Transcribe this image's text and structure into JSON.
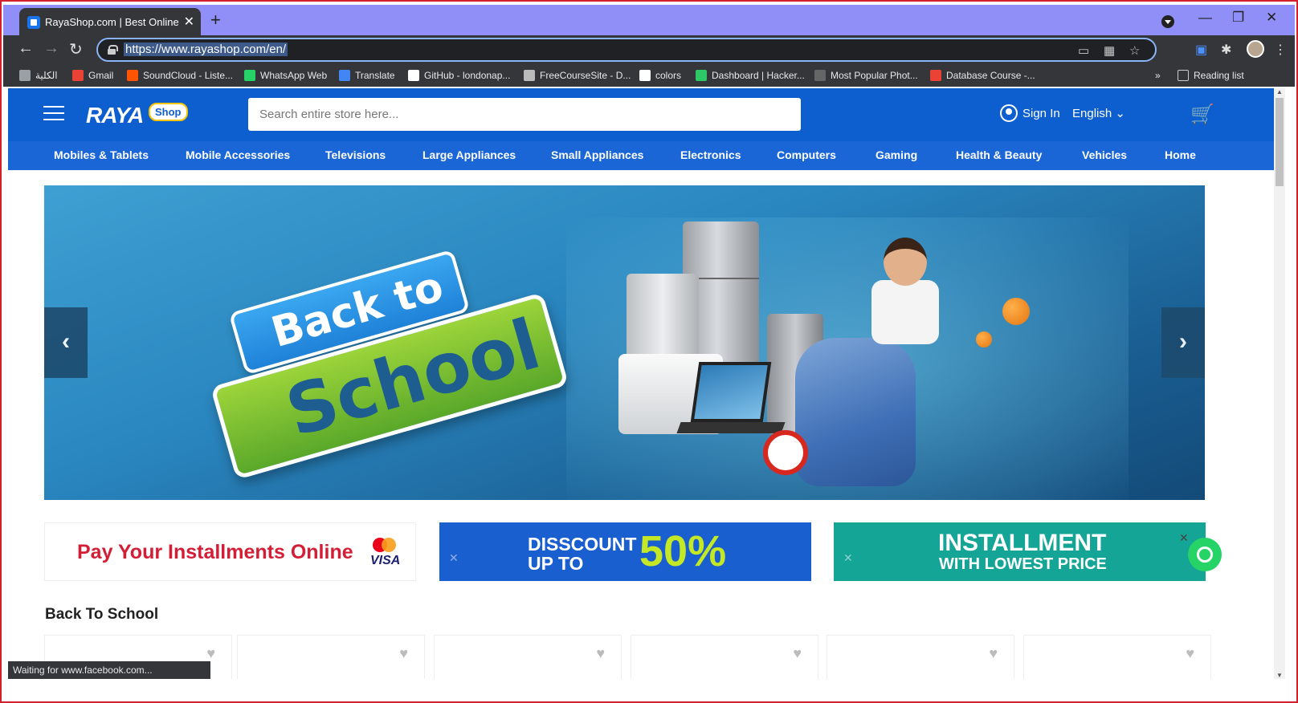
{
  "browser": {
    "tab_title": "RayaShop.com | Best Online Shop",
    "new_tab": "+",
    "tab_close": "✕",
    "url": "https://www.rayashop.com/en/",
    "window": {
      "minimize": "—",
      "restore": "❐",
      "close": "✕"
    },
    "bookmarks": [
      {
        "label": "الكلية",
        "icon": "bookmark-page-icon",
        "color": "#9aa0a6"
      },
      {
        "label": "Gmail",
        "icon": "gmail-icon",
        "color": "#ea4335"
      },
      {
        "label": "SoundCloud - Liste...",
        "icon": "soundcloud-icon",
        "color": "#ff5500"
      },
      {
        "label": "WhatsApp Web",
        "icon": "whatsapp-icon",
        "color": "#25d366"
      },
      {
        "label": "Translate",
        "icon": "translate-icon",
        "color": "#4285f4"
      },
      {
        "label": "GitHub - londonap...",
        "icon": "github-icon",
        "color": "#ffffff"
      },
      {
        "label": "FreeCourseSite - D...",
        "icon": "freecourse-icon",
        "color": "#bbbbbb"
      },
      {
        "label": "colors",
        "icon": "colors-icon",
        "color": "#ffffff"
      },
      {
        "label": "Dashboard | Hacker...",
        "icon": "hackerrank-icon",
        "color": "#2ec866"
      },
      {
        "label": "Most Popular Phot...",
        "icon": "photo-icon",
        "color": "#666666"
      },
      {
        "label": "Database Course -...",
        "icon": "gmail-icon",
        "color": "#ea4335"
      }
    ],
    "bookmarks_more": "»",
    "reading_list": "Reading list",
    "status": "Waiting for www.facebook.com..."
  },
  "site": {
    "logo_main": "RAYA",
    "logo_shop": "Shop",
    "search_placeholder": "Search entire store here...",
    "sign_in": "Sign In",
    "language": "English ⌄",
    "cart": "🛒",
    "categories": [
      "Mobiles & Tablets",
      "Mobile Accessories",
      "Televisions",
      "Large Appliances",
      "Small Appliances",
      "Electronics",
      "Computers",
      "Gaming",
      "Health & Beauty",
      "Vehicles",
      "Home"
    ],
    "hero": {
      "line1": "Back to",
      "line2": "School",
      "prev": "‹",
      "next": "›"
    },
    "promos": {
      "installments": "Pay Your Installments Online",
      "visa": "VISA",
      "discount_l1": "DISSCOUNT",
      "discount_l2": "UP TO",
      "discount_pct": "50%",
      "install_l1": "INSTALLMENT",
      "install_l2": "WITH LOWEST PRICE"
    },
    "section_title": "Back To School",
    "wishlist_icon": "♥",
    "whatsapp_close": "✕"
  },
  "colors": {
    "brand": "#0d5fd0",
    "accent_green": "#c4e825",
    "teal": "#14a596",
    "red": "#d31e35"
  }
}
